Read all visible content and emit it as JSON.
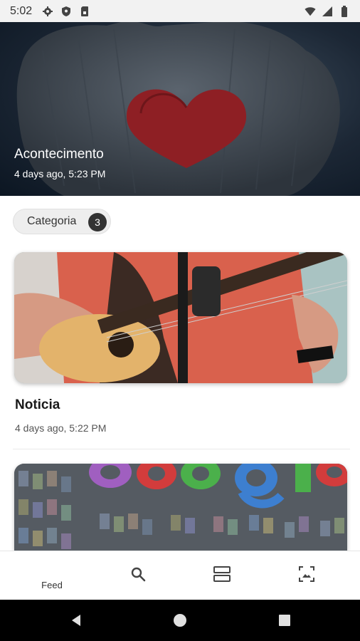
{
  "status_bar": {
    "time": "5:02",
    "left_icons": [
      "settings-icon",
      "shield-icon",
      "sim-card-icon"
    ],
    "right_icons": [
      "wifi-icon",
      "signal-icon",
      "battery-icon"
    ]
  },
  "hero": {
    "title": "Acontecimento",
    "timestamp": "4 days ago, 5:23 PM"
  },
  "category_chip": {
    "label": "Categoria",
    "count": "3"
  },
  "feed": [
    {
      "title": "Noticia",
      "timestamp": "4 days ago, 5:22 PM",
      "image": "guitar-player-photo"
    },
    {
      "title": "",
      "timestamp": "",
      "image": "google-logo-collage-photo"
    }
  ],
  "bottom_nav": {
    "items": [
      {
        "label": "Feed",
        "icon": ""
      },
      {
        "label": "",
        "icon": "search-icon"
      },
      {
        "label": "",
        "icon": "view-agenda-icon"
      },
      {
        "label": "",
        "icon": "photo-frame-icon"
      }
    ]
  },
  "system_nav": [
    "back-icon",
    "home-icon",
    "recents-icon"
  ]
}
